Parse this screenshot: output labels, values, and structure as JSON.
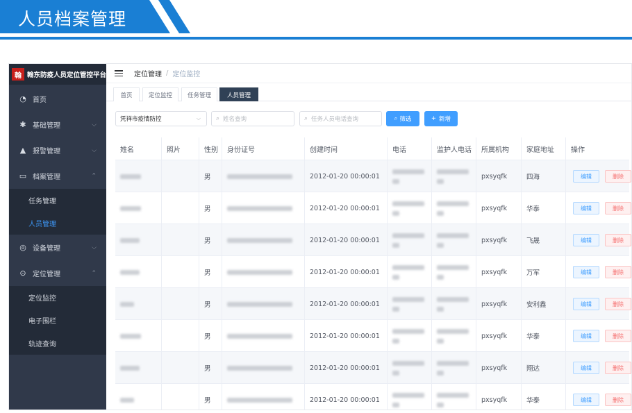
{
  "banner": {
    "title": "人员档案管理"
  },
  "app": {
    "name": "翰东防疫人员定位管控平台",
    "logo_text": "翰东"
  },
  "sidebar": {
    "items": [
      {
        "label": "首页",
        "icon": "dashboard-icon"
      },
      {
        "label": "基础管理",
        "icon": "gear-icon"
      },
      {
        "label": "报警管理",
        "icon": "bell-icon"
      },
      {
        "label": "档案管理",
        "icon": "folder-icon"
      },
      {
        "label": "设备管理",
        "icon": "watch-icon"
      },
      {
        "label": "定位管理",
        "icon": "location-pin-icon"
      }
    ],
    "archive_sub": [
      {
        "label": "任务管理"
      },
      {
        "label": "人员管理"
      }
    ],
    "location_sub": [
      {
        "label": "定位监控"
      },
      {
        "label": "电子围栏"
      },
      {
        "label": "轨迹查询"
      }
    ]
  },
  "breadcrumb": {
    "parent": "定位管理",
    "separator": "/",
    "current": "定位监控"
  },
  "tabs": [
    {
      "label": "首页"
    },
    {
      "label": "定位监控"
    },
    {
      "label": "任务管理"
    },
    {
      "label": "人员管理"
    }
  ],
  "filters": {
    "region_value": "凭祥市疫情防控",
    "name_placeholder": "姓名查询",
    "phone_placeholder": "任务人员电话查询",
    "search_label": "筛选",
    "add_label": "新增"
  },
  "table": {
    "headers": [
      "姓名",
      "照片",
      "性别",
      "身份证号",
      "创建时间",
      "电话",
      "监护人电话",
      "所属机构",
      "家庭地址",
      "操作"
    ],
    "edit_label": "编辑",
    "delete_label": "删除",
    "rows": [
      {
        "gender": "男",
        "created": "2012-01-20 00:00:01",
        "org": "pxsyqfk",
        "address": "四海"
      },
      {
        "gender": "男",
        "created": "2012-01-20 00:00:01",
        "org": "pxsyqfk",
        "address": "华泰"
      },
      {
        "gender": "男",
        "created": "2012-01-20 00:00:01",
        "org": "pxsyqfk",
        "address": "飞晟"
      },
      {
        "gender": "男",
        "created": "2012-01-20 00:00:01",
        "org": "pxsyqfk",
        "address": "万军"
      },
      {
        "gender": "男",
        "created": "2012-01-20 00:00:01",
        "org": "pxsyqfk",
        "address": "安利鑫"
      },
      {
        "gender": "男",
        "created": "2012-01-20 00:00:01",
        "org": "pxsyqfk",
        "address": "华泰"
      },
      {
        "gender": "男",
        "created": "2012-01-20 00:00:01",
        "org": "pxsyqfk",
        "address": "翔达"
      },
      {
        "gender": "男",
        "created": "2012-01-20 00:00:01",
        "org": "pxsyqfk",
        "address": "华泰"
      }
    ]
  }
}
